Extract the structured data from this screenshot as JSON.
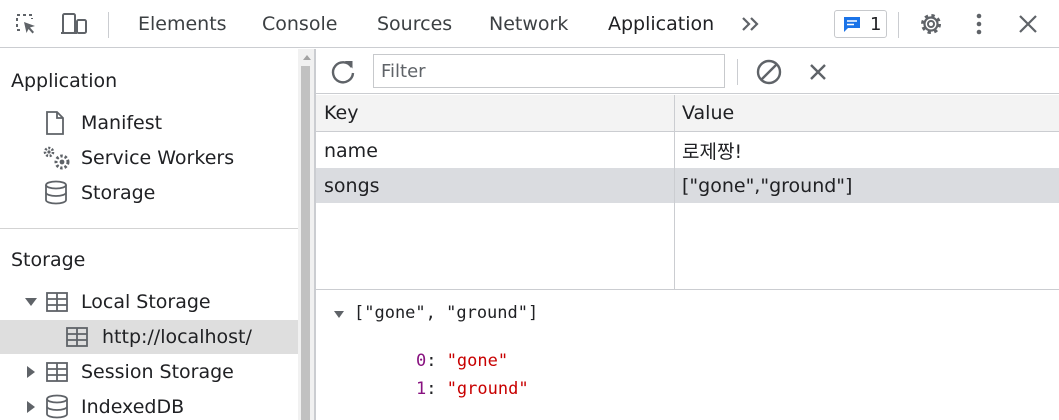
{
  "toolbar": {
    "tabs": [
      "Elements",
      "Console",
      "Sources",
      "Network",
      "Application"
    ],
    "overflow_label": "»",
    "issues_count": "1"
  },
  "sidebar": {
    "application_title": "Application",
    "application_items": [
      "Manifest",
      "Service Workers",
      "Storage"
    ],
    "storage_title": "Storage",
    "storage_items": [
      "Local Storage",
      "http://localhost/",
      "Session Storage",
      "IndexedDB"
    ]
  },
  "main": {
    "filter_placeholder": "Filter",
    "columns": [
      "Key",
      "Value"
    ],
    "rows": [
      {
        "key": "name",
        "value": "로제짱!"
      },
      {
        "key": "songs",
        "value": "[\"gone\",\"ground\"]"
      }
    ],
    "selected_row": 1
  },
  "preview": {
    "summary": "[\"gone\", \"ground\"]",
    "items": [
      {
        "index": "0",
        "value": "\"gone\""
      },
      {
        "index": "1",
        "value": "\"ground\""
      }
    ]
  },
  "colors": {
    "accent": "#1a73e8",
    "selected_row": "#dadce0",
    "preview_index": "#881280",
    "preview_string": "#c80000"
  },
  "icons": [
    "inspect-element-icon",
    "device-toolbar-icon",
    "issues-message-icon",
    "gear-icon",
    "more-vert-icon",
    "close-icon",
    "refresh-icon",
    "clear-all-icon",
    "delete-selected-icon",
    "document-icon",
    "cogs-icon",
    "database-icon",
    "table-icon"
  ]
}
